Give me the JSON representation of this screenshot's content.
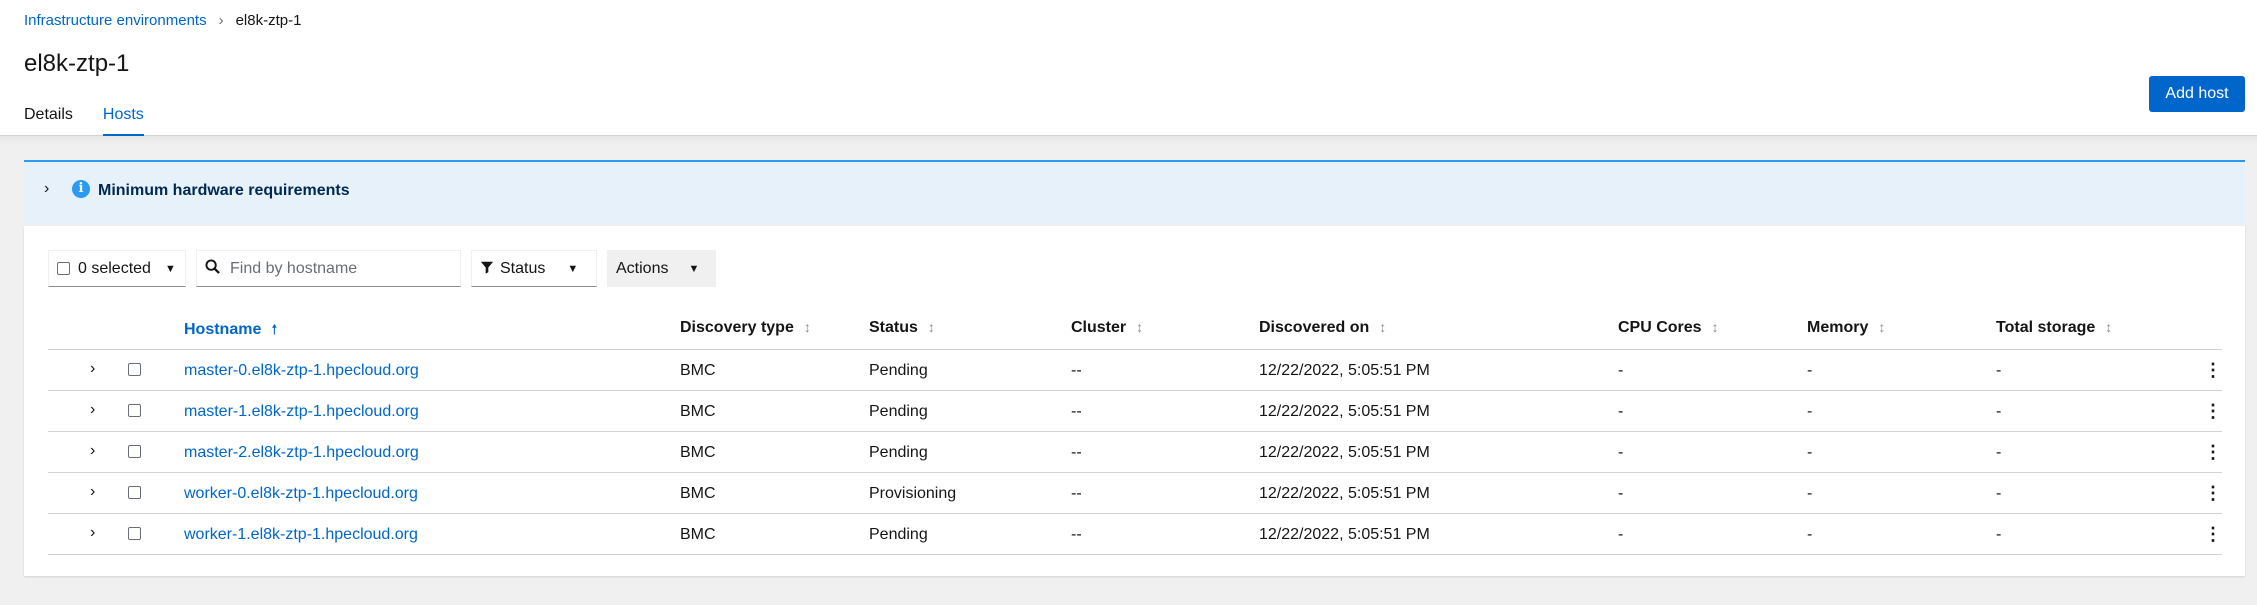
{
  "breadcrumb": {
    "parent": "Infrastructure environments",
    "separator": "›",
    "current": "el8k-ztp-1"
  },
  "page": {
    "title": "el8k-ztp-1"
  },
  "tabs": [
    {
      "label": "Details",
      "active": false
    },
    {
      "label": "Hosts",
      "active": true
    }
  ],
  "add_host_label": "Add host",
  "alert": {
    "title": "Minimum hardware requirements",
    "toggle": "›",
    "icon": "info-circle-icon"
  },
  "toolbar": {
    "bulk_select_label": "0 selected",
    "search_placeholder": "Find by hostname",
    "status_filter_label": "Status",
    "actions_label": "Actions"
  },
  "table": {
    "headers": {
      "hostname": "Hostname",
      "discovery_type": "Discovery type",
      "status": "Status",
      "cluster": "Cluster",
      "discovered_on": "Discovered on",
      "cpu_cores": "CPU Cores",
      "memory": "Memory",
      "total_storage": "Total storage"
    },
    "sorted_by": "hostname",
    "rows": [
      {
        "hostname": "master-0.el8k-ztp-1.hpecloud.org",
        "discovery_type": "BMC",
        "status": "Pending",
        "cluster": "--",
        "discovered_on": "12/22/2022, 5:05:51 PM",
        "cpu_cores": "-",
        "memory": "-",
        "total_storage": "-"
      },
      {
        "hostname": "master-1.el8k-ztp-1.hpecloud.org",
        "discovery_type": "BMC",
        "status": "Pending",
        "cluster": "--",
        "discovered_on": "12/22/2022, 5:05:51 PM",
        "cpu_cores": "-",
        "memory": "-",
        "total_storage": "-"
      },
      {
        "hostname": "master-2.el8k-ztp-1.hpecloud.org",
        "discovery_type": "BMC",
        "status": "Pending",
        "cluster": "--",
        "discovered_on": "12/22/2022, 5:05:51 PM",
        "cpu_cores": "-",
        "memory": "-",
        "total_storage": "-"
      },
      {
        "hostname": "worker-0.el8k-ztp-1.hpecloud.org",
        "discovery_type": "BMC",
        "status": "Provisioning",
        "cluster": "--",
        "discovered_on": "12/22/2022, 5:05:51 PM",
        "cpu_cores": "-",
        "memory": "-",
        "total_storage": "-"
      },
      {
        "hostname": "worker-1.el8k-ztp-1.hpecloud.org",
        "discovery_type": "BMC",
        "status": "Pending",
        "cluster": "--",
        "discovered_on": "12/22/2022, 5:05:51 PM",
        "cpu_cores": "-",
        "memory": "-",
        "total_storage": "-"
      }
    ]
  },
  "colors": {
    "link": "#0066cc",
    "primary_button": "#0066cc",
    "alert_bg": "#e7f1fa",
    "alert_border": "#2b9af3"
  }
}
